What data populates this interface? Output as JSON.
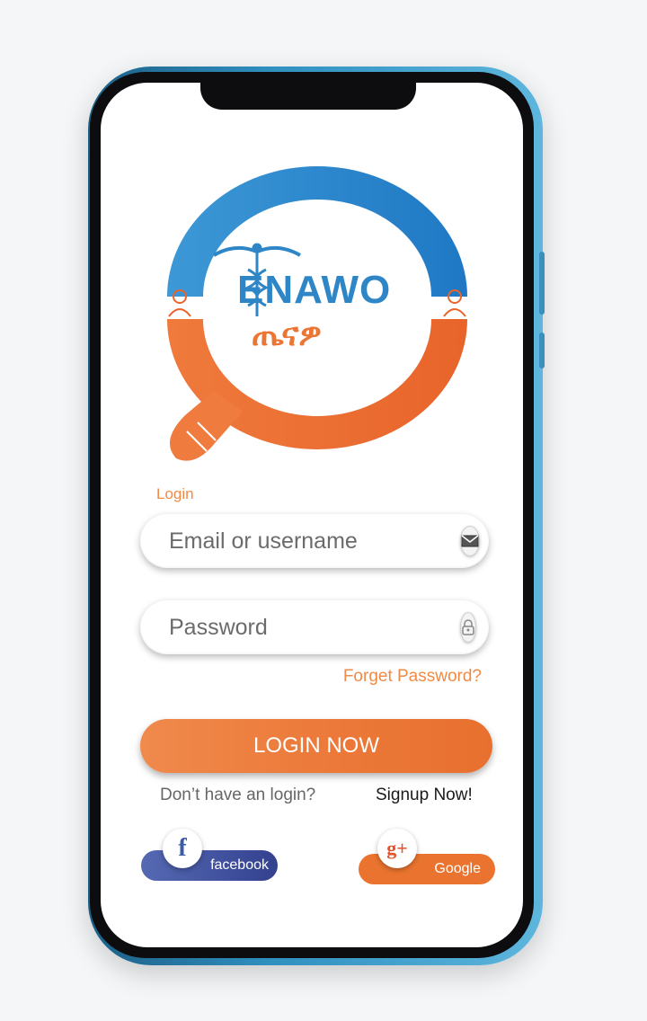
{
  "logo": {
    "wordmark": "ENAWO",
    "amharic": "ጤናዎ",
    "colors": {
      "blue": "#2f86c6",
      "orange": "#ea7535"
    }
  },
  "form": {
    "caption": "Login",
    "email_placeholder": "Email or username",
    "email_icon": "mail-icon",
    "password_placeholder": "Password",
    "password_icon": "lock-icon",
    "forget_link": "Forget Password?",
    "login_button": "LOGIN NOW"
  },
  "signup": {
    "prompt": "Don’t have an login?",
    "link": "Signup Now!"
  },
  "social": {
    "facebook": {
      "label": "facebook",
      "glyph": "f",
      "color": "#3b4b9e"
    },
    "google": {
      "label": "Google",
      "glyph": "g+",
      "color": "#ea742f"
    }
  }
}
